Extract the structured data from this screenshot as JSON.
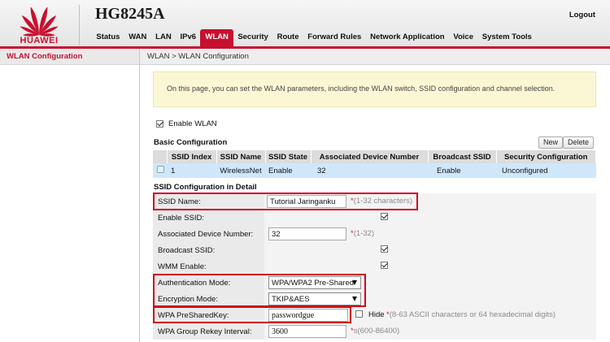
{
  "header": {
    "brand": "HUAWEI",
    "model": "HG8245A",
    "logout": "Logout",
    "brand_color": "#c8102e",
    "nav": [
      "Status",
      "WAN",
      "LAN",
      "IPv6",
      "WLAN",
      "Security",
      "Route",
      "Forward Rules",
      "Network Application",
      "Voice",
      "System Tools"
    ],
    "active_nav": "WLAN"
  },
  "sidebar": {
    "items": [
      {
        "label": "WLAN Configuration"
      }
    ]
  },
  "breadcrumb": "WLAN > WLAN Configuration",
  "info": "On this page, you can set the WLAN parameters, including the WLAN switch, SSID configuration and channel selection.",
  "enable_wlan": {
    "label": "Enable WLAN",
    "checked": true
  },
  "basic": {
    "title": "Basic Configuration",
    "new_label": "New",
    "delete_label": "Delete",
    "columns": [
      "SSID Index",
      "SSID Name",
      "SSID State",
      "Associated Device Number",
      "Broadcast SSID",
      "Security Configuration"
    ],
    "rows": [
      {
        "index": "1",
        "name": "WirelessNet",
        "state": "Enable",
        "assoc": "32",
        "broadcast": "Enable",
        "security": "Unconfigured"
      }
    ]
  },
  "detail": {
    "title": "SSID Configuration in Detail",
    "ssid_name": {
      "label": "SSID Name:",
      "value": "Tutorial Jaringanku",
      "hint_star": "*",
      "hint": "(1-32 characters)"
    },
    "enable_ssid": {
      "label": "Enable SSID:",
      "checked": true
    },
    "assoc_num": {
      "label": "Associated Device Number:",
      "value": "32",
      "hint_star": "*",
      "hint": "(1-32)"
    },
    "broadcast": {
      "label": "Broadcast SSID:",
      "checked": true
    },
    "wmm": {
      "label": "WMM Enable:",
      "checked": true
    },
    "auth_mode": {
      "label": "Authentication Mode:",
      "value": "WPA/WPA2 Pre-Shared"
    },
    "enc_mode": {
      "label": "Encryption Mode:",
      "value": "TKIP&AES"
    },
    "psk": {
      "label": "WPA PreSharedKey:",
      "value": "passwordgue",
      "hide_label": "Hide",
      "hint_star": "*",
      "hint": "(8-63 ASCII characters or 64 hexadecimal digits)"
    },
    "rekey": {
      "label": "WPA Group Rekey Interval:",
      "value": "3600",
      "hint_star": "*",
      "hint": "s(600-86400)"
    }
  }
}
